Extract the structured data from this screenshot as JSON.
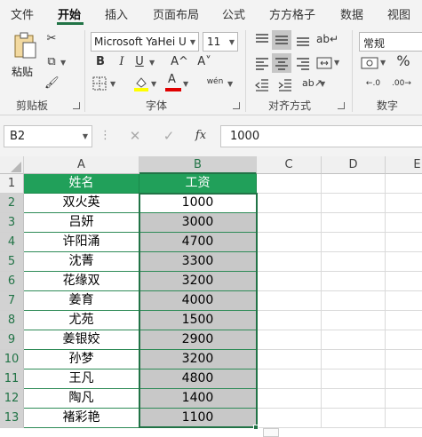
{
  "tabs": [
    "文件",
    "开始",
    "插入",
    "页面布局",
    "公式",
    "方方格子",
    "数据",
    "视图"
  ],
  "active_tab": "开始",
  "ribbon": {
    "clipboard": {
      "paste_label": "粘贴",
      "group_label": "剪贴板"
    },
    "font": {
      "font_name": "Microsoft YaHei UI",
      "font_size": "11",
      "bold": "B",
      "italic": "I",
      "underline": "U",
      "grow": "A^",
      "shrink": "A˅",
      "wen": "wén",
      "group_label": "字体",
      "highlight_color": "#ffff00",
      "font_color": "#e00000"
    },
    "alignment": {
      "group_label": "对齐方式"
    },
    "number": {
      "format": "常规",
      "percent": "%",
      "group_label": "数字"
    }
  },
  "formula_bar": {
    "name_box": "B2",
    "fx_label": "fx",
    "value": "1000"
  },
  "columns": [
    "A",
    "B",
    "C",
    "D",
    "E"
  ],
  "rows": [
    "1",
    "2",
    "3",
    "4",
    "5",
    "6",
    "7",
    "8",
    "9",
    "10",
    "11",
    "12",
    "13"
  ],
  "table": {
    "headers": [
      "姓名",
      "工资"
    ],
    "rows": [
      [
        "双火英",
        "1000"
      ],
      [
        "吕妍",
        "3000"
      ],
      [
        "许阳涌",
        "4700"
      ],
      [
        "沈菁",
        "3300"
      ],
      [
        "花缘双",
        "3200"
      ],
      [
        "姜育",
        "4000"
      ],
      [
        "尤苑",
        "1500"
      ],
      [
        "姜银姣",
        "2900"
      ],
      [
        "孙梦",
        "3200"
      ],
      [
        "王凡",
        "4800"
      ],
      [
        "陶凡",
        "1400"
      ],
      [
        "褚彩艳",
        "1100"
      ]
    ]
  },
  "colors": {
    "accent": "#217346",
    "header_fill": "#21a05a",
    "selection_fill": "#c8c8c8"
  }
}
